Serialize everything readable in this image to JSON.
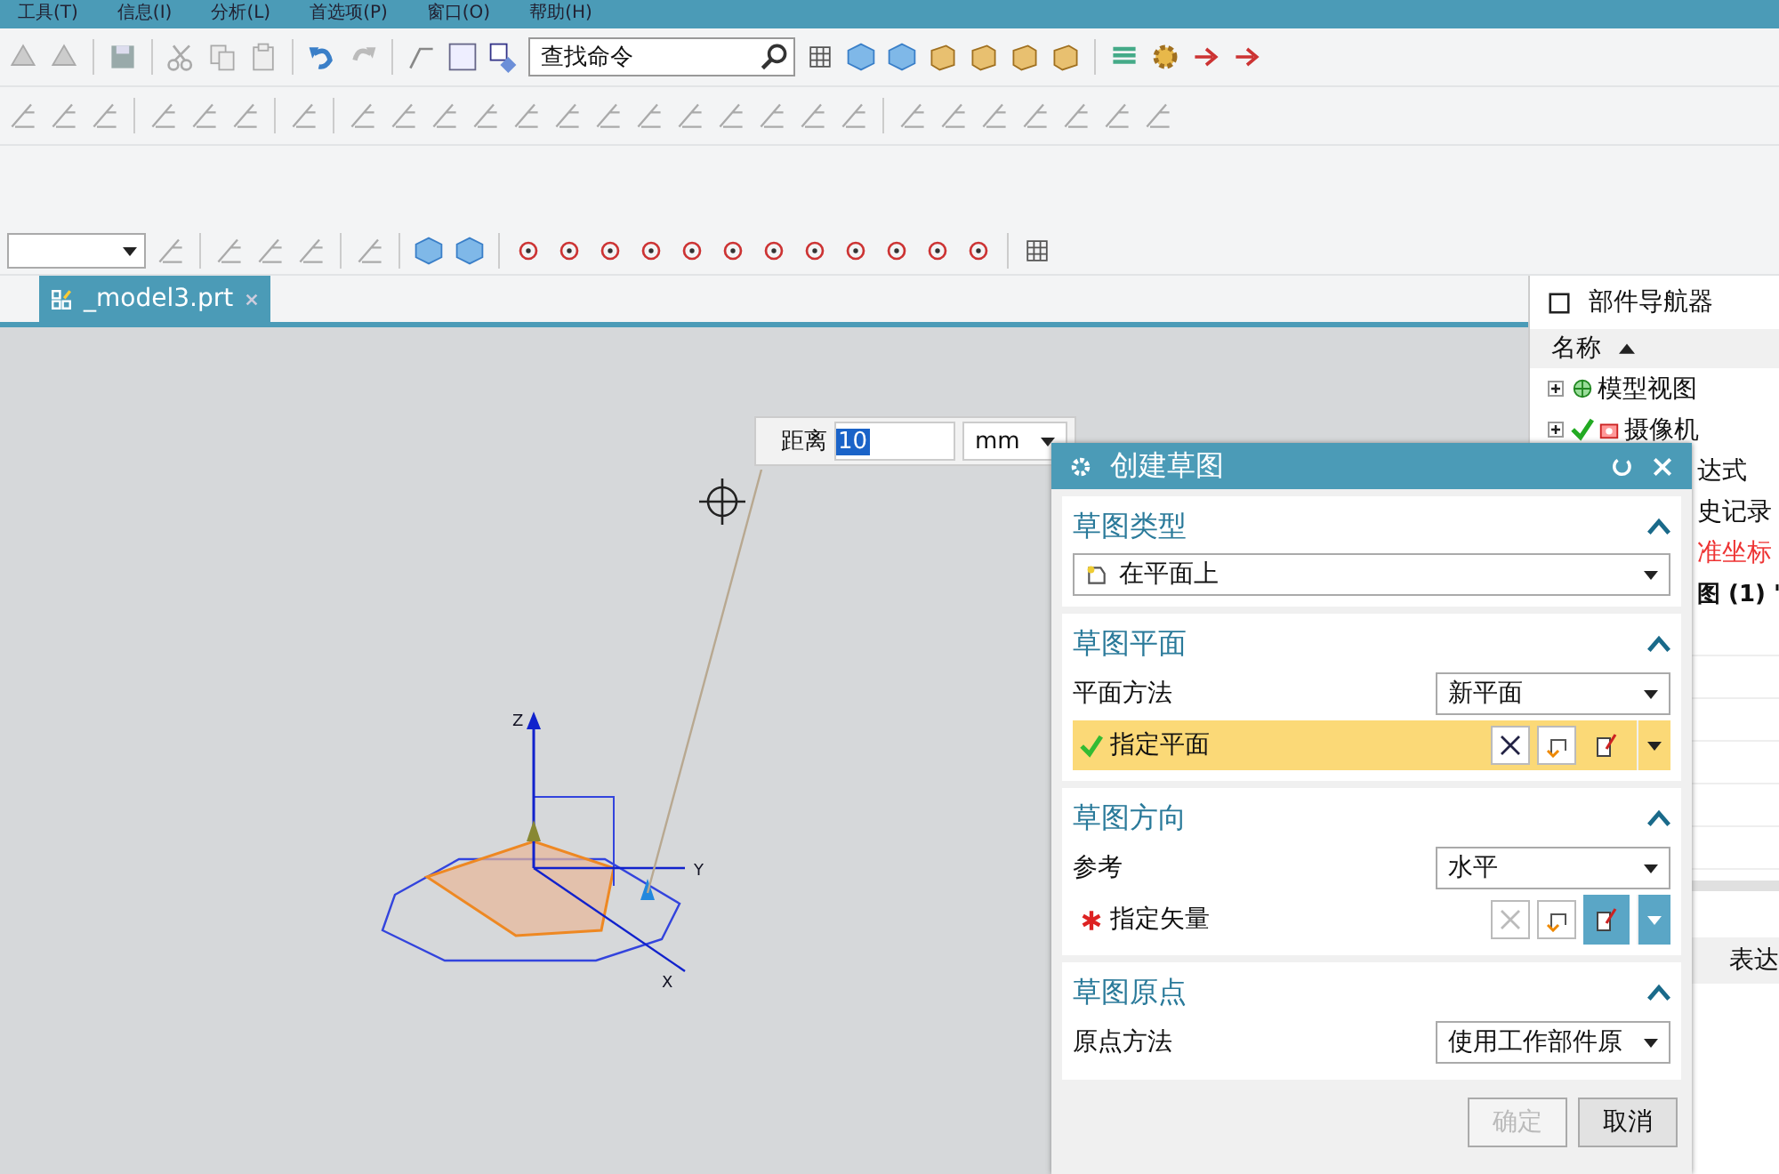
{
  "menu": [
    "工具(T)",
    "信息(I)",
    "分析(L)",
    "首选项(P)",
    "窗口(O)",
    "帮助(H)"
  ],
  "search": {
    "placeholder": "查找命令"
  },
  "tabs": [
    {
      "label": "_model3.prt",
      "selected": true
    }
  ],
  "dimension": {
    "label": "距离",
    "value": "10",
    "unit": "mm"
  },
  "axes": [
    "Z",
    "Y",
    "X"
  ],
  "navigator": {
    "title": "部件导航器",
    "column": "名称",
    "items": [
      {
        "label": "模型视图",
        "kind": "view",
        "expanded": false,
        "checked": false
      },
      {
        "label": "摄像机",
        "kind": "camera",
        "expanded": false,
        "checked": true
      },
      {
        "label": "达式",
        "kind": "partial"
      },
      {
        "label": "史记录",
        "kind": "partial"
      },
      {
        "label": "准坐标",
        "kind": "warning"
      },
      {
        "label": "图 (1) '",
        "kind": "bold"
      }
    ],
    "detail_column": "表达"
  },
  "dialog": {
    "title": "创建草图",
    "sections": [
      {
        "title": "草图类型",
        "expanded": true,
        "rows": [
          {
            "kind": "select",
            "value": "在平面上"
          }
        ]
      },
      {
        "title": "草图平面",
        "expanded": true,
        "rows": [
          {
            "kind": "labeled-select",
            "label": "平面方法",
            "value": "新平面"
          },
          {
            "kind": "selector",
            "label": "指定平面",
            "complete": true,
            "selected": true
          }
        ]
      },
      {
        "title": "草图方向",
        "expanded": true,
        "rows": [
          {
            "kind": "labeled-select",
            "label": "参考",
            "value": "水平"
          },
          {
            "kind": "selector",
            "label": "指定矢量",
            "complete": false,
            "selected": false
          }
        ]
      },
      {
        "title": "草图原点",
        "expanded": true,
        "rows": [
          {
            "kind": "labeled-select",
            "label": "原点方法",
            "value": "使用工作部件原"
          }
        ]
      }
    ],
    "buttons": [
      {
        "label": "确定",
        "disabled": true
      },
      {
        "label": "取消",
        "disabled": false
      }
    ]
  }
}
